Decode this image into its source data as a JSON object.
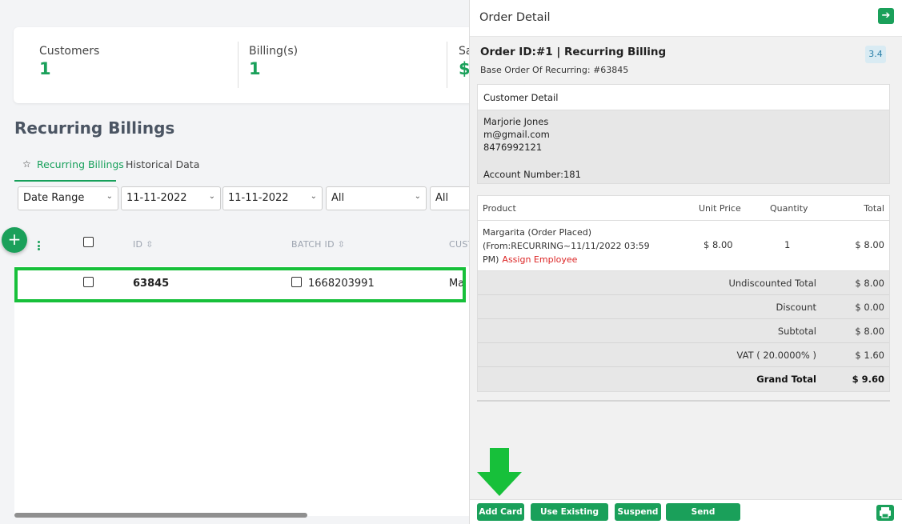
{
  "stats": [
    {
      "label": "Customers",
      "value": "1"
    },
    {
      "label": "Billing(s)",
      "value": "1"
    },
    {
      "label": "Sa",
      "value": "$"
    }
  ],
  "page_title": "Recurring Billings",
  "tabs": {
    "active": "Recurring Billings",
    "inactive": "Historical Data"
  },
  "filters": {
    "date_range": "Date Range",
    "date_from": "11-11-2022",
    "date_to": "11-11-2022",
    "filter1": "All",
    "filter2": "All"
  },
  "table": {
    "headers": {
      "id": "ID",
      "batch_id": "BATCH ID",
      "customer": "CUST"
    },
    "rows": [
      {
        "id": "63845",
        "batch_id": "1668203991",
        "customer": "Ma"
      }
    ]
  },
  "panel": {
    "title": "Order Detail",
    "order_title": "Order ID:#1 | Recurring Billing",
    "order_sub": "Base Order Of Recurring: #63845",
    "version": "3.4",
    "customer": {
      "heading": "Customer Detail",
      "name": "Marjorie Jones",
      "email": "m@gmail.com",
      "phone": "8476992121",
      "account": "Account Number:181"
    },
    "products": {
      "headers": {
        "product": "Product",
        "unit_price": "Unit Price",
        "quantity": "Quantity",
        "total": "Total"
      },
      "item": {
        "name": "Margarita (Order Placed) (From:RECURRING~11/11/2022 03:59 PM)",
        "assign": "Assign Employee",
        "unit_price": "$ 8.00",
        "quantity": "1",
        "total": "$ 8.00"
      },
      "totals": [
        {
          "label": "Undiscounted Total",
          "value": "$ 8.00"
        },
        {
          "label": "Discount",
          "value": "$ 0.00"
        },
        {
          "label": "Subtotal",
          "value": "$ 8.00"
        },
        {
          "label": "VAT ( 20.0000% )",
          "value": "$ 1.60"
        },
        {
          "label": "Grand Total",
          "value": "$ 9.60"
        }
      ]
    },
    "footer_buttons": {
      "add_card": "Add Card",
      "use_existing": "Use Existing Card",
      "suspend": "Suspend",
      "send_agreement": "Send Agreement"
    }
  },
  "colors": {
    "accent": "#1aa05a",
    "highlight": "#17c03a",
    "danger": "#dc2626"
  }
}
